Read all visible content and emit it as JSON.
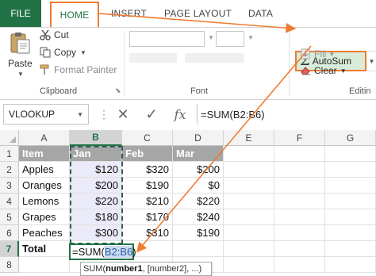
{
  "ribbon_tabs": {
    "file": "FILE",
    "home": "HOME",
    "insert": "INSERT",
    "page_layout": "PAGE LAYOUT",
    "data": "DATA"
  },
  "clipboard": {
    "paste": "Paste",
    "cut": "Cut",
    "copy": "Copy",
    "format_painter": "Format Painter",
    "group_label": "Clipboard"
  },
  "font_group": {
    "group_label": "Font"
  },
  "editing": {
    "autosum": "AutoSum",
    "fill": "Fill",
    "clear": "Clear",
    "group_label": "Editin"
  },
  "formula_bar": {
    "name_box": "VLOOKUP",
    "formula": "=SUM(B2:B6)"
  },
  "columns": [
    "A",
    "B",
    "C",
    "D",
    "E",
    "F",
    "G"
  ],
  "rows": [
    "1",
    "2",
    "3",
    "4",
    "5",
    "6",
    "7",
    "8"
  ],
  "table": {
    "headers": [
      "Item",
      "Jan",
      "Feb",
      "Mar"
    ],
    "data": [
      [
        "Apples",
        "$120",
        "$320",
        "$200"
      ],
      [
        "Oranges",
        "$200",
        "$190",
        "$0"
      ],
      [
        "Lemons",
        "$220",
        "$210",
        "$220"
      ],
      [
        "Grapes",
        "$180",
        "$170",
        "$240"
      ],
      [
        "Peaches",
        "$300",
        "$310",
        "$190"
      ]
    ],
    "total_label": "Total"
  },
  "active_cell": {
    "prefix": "=SUM(",
    "ref": "B2:B6",
    "suffix": ")"
  },
  "tooltip": {
    "func": "SUM(",
    "arg1": "number1",
    "rest": ", [number2], ...)"
  },
  "colors": {
    "excel_green": "#217346",
    "highlight_orange": "#ef7b31",
    "header_gray": "#a6a6a6",
    "selection_tint": "#eaeaf8"
  }
}
